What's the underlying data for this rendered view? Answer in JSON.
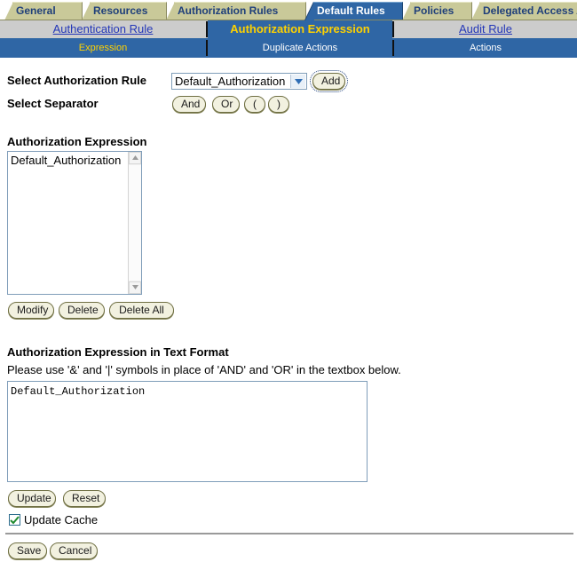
{
  "tabs": {
    "items": [
      {
        "label": "General",
        "active": false
      },
      {
        "label": "Resources",
        "active": false
      },
      {
        "label": "Authorization Rules",
        "active": false
      },
      {
        "label": "Default Rules",
        "active": true
      },
      {
        "label": "Policies",
        "active": false
      },
      {
        "label": "Delegated Access Admins",
        "active": false
      }
    ]
  },
  "subnav": {
    "items": [
      {
        "label": "Authentication Rule",
        "active": false
      },
      {
        "label": "Authorization Expression",
        "active": true
      },
      {
        "label": "Audit Rule",
        "active": false
      }
    ]
  },
  "actionnav": {
    "items": [
      {
        "label": "Expression",
        "active": true
      },
      {
        "label": "Duplicate Actions",
        "active": false
      },
      {
        "label": "Actions",
        "active": false
      }
    ]
  },
  "form": {
    "select_rule_label": "Select Authorization Rule",
    "select_separator_label": "Select Separator",
    "rule_select_value": "Default_Authorization",
    "rule_select_icon": "chevron-down-icon",
    "add_button": "Add",
    "separators": [
      {
        "label": "And"
      },
      {
        "label": "Or"
      },
      {
        "label": "("
      },
      {
        "label": ")"
      }
    ]
  },
  "expression_section": {
    "title": "Authorization Expression",
    "items": [
      "Default_Authorization"
    ],
    "buttons": [
      {
        "label": "Modify"
      },
      {
        "label": "Delete"
      },
      {
        "label": "Delete All"
      }
    ]
  },
  "text_format_section": {
    "title": "Authorization Expression in Text Format",
    "hint": "Please use '&' and '|' symbols in place of 'AND' and 'OR' in the textbox below.",
    "value": "Default_Authorization",
    "buttons": [
      {
        "label": "Update"
      },
      {
        "label": "Reset"
      }
    ],
    "update_cache_label": "Update Cache",
    "update_cache_checked": true,
    "check_icon": "check-icon"
  },
  "footer": {
    "buttons": [
      {
        "label": "Save"
      },
      {
        "label": "Cancel"
      }
    ]
  },
  "colors": {
    "tab_inactive": "#c9c999",
    "tab_active": "#2f66a5",
    "nav_blue": "#2f66a5",
    "nav_active_text": "#ffd200",
    "link_blue": "#2437b8",
    "subnav_bg": "#cccccc",
    "button_face": "#f2f1e0",
    "check_green": "#1f8a2f"
  }
}
